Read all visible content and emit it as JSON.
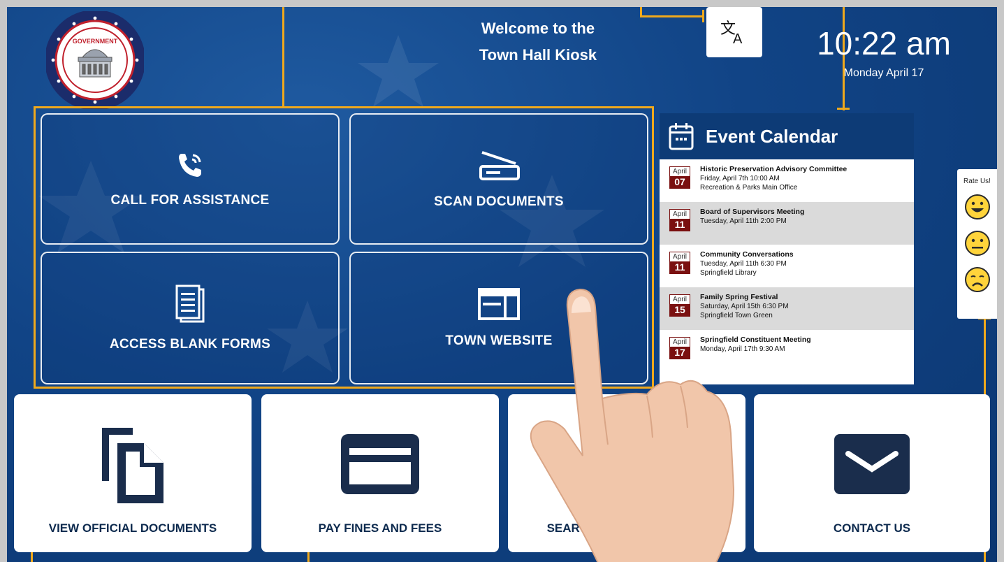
{
  "header": {
    "welcome_line1": "Welcome to the",
    "welcome_line2": "Town Hall Kiosk",
    "time": "10:22 am",
    "date": "Monday April 17",
    "logo_text": "GOVERNMENT"
  },
  "tiles": {
    "call": "CALL FOR ASSISTANCE",
    "scan": "SCAN DOCUMENTS",
    "forms": "ACCESS BLANK FORMS",
    "website": "TOWN WEBSITE"
  },
  "calendar": {
    "title": "Event Calendar",
    "events": [
      {
        "month": "April",
        "day": "07",
        "title": "Historic Preservation Advisory Committee",
        "line1": "Friday, April 7th 10:00 AM",
        "line2": "Recreation & Parks Main Office"
      },
      {
        "month": "April",
        "day": "11",
        "title": "Board of Supervisors Meeting",
        "line1": "Tuesday, April 11th 2:00 PM",
        "line2": ""
      },
      {
        "month": "April",
        "day": "11",
        "title": "Community Conversations",
        "line1": "Tuesday, April 11th 6:30 PM",
        "line2": "Springfield Library"
      },
      {
        "month": "April",
        "day": "15",
        "title": "Family Spring Festival",
        "line1": "Saturday, April 15th 6:30 PM",
        "line2": "Springfield Town Green"
      },
      {
        "month": "April",
        "day": "17",
        "title": "Springfield Constituent Meeting",
        "line1": "Monday, April 17th 9:30 AM",
        "line2": ""
      }
    ]
  },
  "rating": {
    "label": "Rate Us!"
  },
  "cards": {
    "view_docs": "VIEW OFFICIAL DOCUMENTS",
    "pay": "PAY FINES AND FEES",
    "search": "SEARCH U",
    "contact": "CONTACT US"
  },
  "colors": {
    "background": "#114486",
    "callout": "#f0a91c",
    "calendar_header": "#0d3b76",
    "date_red": "#7a1010",
    "card_text": "#0d2a4e"
  },
  "icons": [
    "logo-seal-icon",
    "translate-icon",
    "phone-icon",
    "scanner-icon",
    "document-icon",
    "website-icon",
    "calendar-icon",
    "happy-face-icon",
    "neutral-face-icon",
    "sad-face-icon",
    "copy-icon",
    "credit-card-icon",
    "envelope-icon",
    "pointing-hand"
  ]
}
